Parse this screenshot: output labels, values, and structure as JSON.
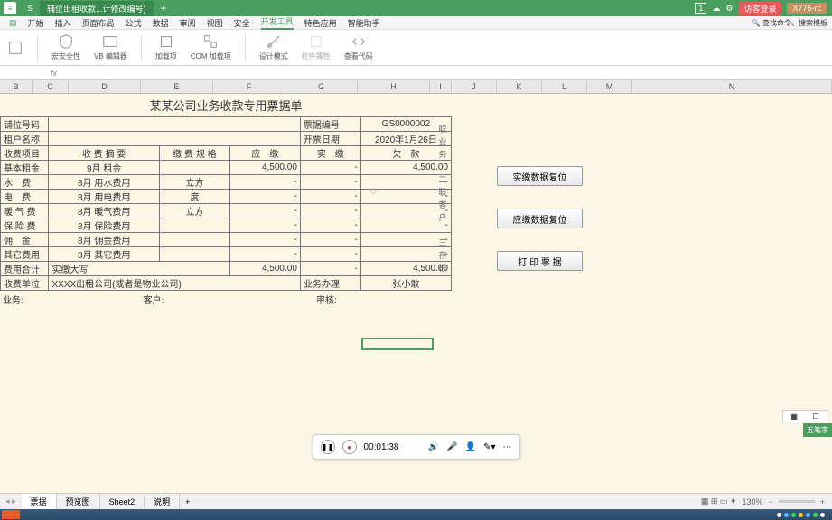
{
  "titlebar": {
    "tab": "辅位出租收款...计修改编号)",
    "plus": "+",
    "num": "1",
    "login": "访客登录",
    "user": "X775-rc"
  },
  "menu": {
    "items": [
      "开始",
      "插入",
      "页面布局",
      "公式",
      "数据",
      "审阅",
      "视图",
      "安全",
      "开发工具",
      "特色应用",
      "智能助手"
    ],
    "active": 8,
    "search": "查找命令、搜索模板"
  },
  "ribbon": {
    "macroSec": "宏安全性",
    "vb": "VB 编辑器",
    "addin": "加载项",
    "com": "COM 加载项",
    "design": "设计模式",
    "ctrlProp": "控件属性",
    "viewCode": "查看代码"
  },
  "fn": {
    "cell": "",
    "fx": "fx"
  },
  "cols": [
    "B",
    "C",
    "D",
    "E",
    "F",
    "G",
    "H",
    "I",
    "J",
    "K",
    "L",
    "M",
    "N"
  ],
  "receipt": {
    "title": "某某公司业务收款专用票据单",
    "lbl_booth": "铺位号码",
    "lbl_tenant": "租户名称",
    "lbl_docno": "票据编号",
    "val_docno": "GS0000002",
    "lbl_date": "开票日期",
    "val_date": "2020年1月26日",
    "hdr_item": "收费项目",
    "hdr_summary": "收 费 摘 要",
    "hdr_spec": "缴 费 规 格",
    "hdr_due": "应　缴",
    "hdr_paid": "实　缴",
    "hdr_owe": "欠　款",
    "rows": [
      {
        "item": "基本租金",
        "summary": "9月 租金",
        "spec": "",
        "due": "4,500.00",
        "paid": "-",
        "owe": "4,500.00"
      },
      {
        "item": "水　费",
        "summary": "8月 用水费用",
        "spec": "立方",
        "due": "-",
        "paid": "-",
        "owe": "-"
      },
      {
        "item": "电　费",
        "summary": "8月 用电费用",
        "spec": "度",
        "due": "-",
        "paid": "-",
        "owe": "-"
      },
      {
        "item": "暖 气 费",
        "summary": "8月 暖气费用",
        "spec": "立方",
        "due": "-",
        "paid": "-",
        "owe": "-"
      },
      {
        "item": "保 险 费",
        "summary": "8月 保险费用",
        "spec": "",
        "due": "-",
        "paid": "-",
        "owe": "-"
      },
      {
        "item": "佣　金",
        "summary": "8月 佣金费用",
        "spec": "",
        "due": "-",
        "paid": "-",
        "owe": "-"
      },
      {
        "item": "其它费用",
        "summary": "8月 其它费用",
        "spec": "",
        "due": "-",
        "paid": "-",
        "owe": "-"
      }
    ],
    "lbl_total": "费用合计",
    "lbl_amt_cn": "实缴大写",
    "total_due": "4,500.00",
    "total_paid": "-",
    "total_owe": "4,500.00",
    "lbl_unit": "收费单位",
    "val_unit": "XXXX出租公司(或者是物业公司)",
    "lbl_handler": "业务办理",
    "val_handler": "张小敢",
    "lbl_biz": "业务:",
    "lbl_cust": "客户:",
    "lbl_audit": "审核:"
  },
  "sidemarks": [
    "一",
    "联",
    "业",
    "务",
    "",
    "二",
    "联",
    "客",
    "户",
    "",
    "三",
    "存",
    "根"
  ],
  "buttons": {
    "b1": "实缴数据复位",
    "b2": "应缴数据复位",
    "b3": "打 印 票 据"
  },
  "player": {
    "time": "00:01:38"
  },
  "badge": "五笔字",
  "tabs": {
    "items": [
      "票据",
      "预览图",
      "Sheet2",
      "说明"
    ],
    "active": 0
  },
  "status": {
    "zoom": "130%"
  }
}
